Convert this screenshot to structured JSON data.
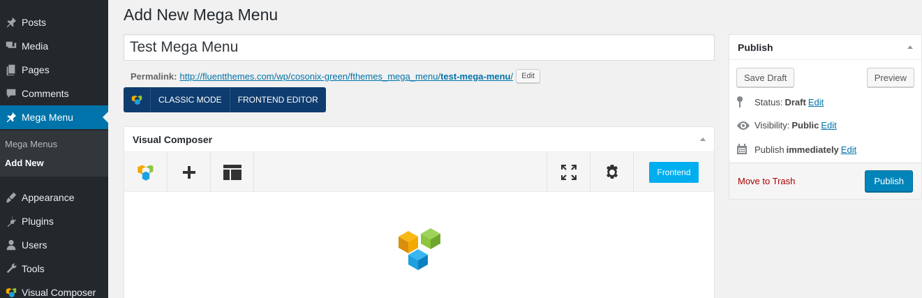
{
  "sidebar": {
    "items_top": [
      {
        "label": "Posts",
        "icon": "pin-icon"
      },
      {
        "label": "Media",
        "icon": "media-icon"
      },
      {
        "label": "Pages",
        "icon": "pages-icon"
      },
      {
        "label": "Comments",
        "icon": "comment-icon"
      },
      {
        "label": "Mega Menu",
        "icon": "pin-icon"
      }
    ],
    "submenu": [
      "Mega Menus",
      "Add New"
    ],
    "items_bottom": [
      {
        "label": "Appearance",
        "icon": "brush-icon"
      },
      {
        "label": "Plugins",
        "icon": "plug-icon"
      },
      {
        "label": "Users",
        "icon": "user-icon"
      },
      {
        "label": "Tools",
        "icon": "wrench-icon"
      },
      {
        "label": "Visual Composer",
        "icon": "vc-logo-icon"
      }
    ],
    "accent_color": "#0073aa"
  },
  "page": {
    "title": "Add New Mega Menu",
    "post_title_value": "Test Mega Menu",
    "permalink_label": "Permalink:",
    "permalink_base": "http://fluentthemes.com/wp/cosonix-green/fthemes_mega_menu/",
    "permalink_slug": "test-mega-menu",
    "permalink_trail": "/",
    "permalink_edit": "Edit"
  },
  "vc_toggle": {
    "classic": "CLASSIC MODE",
    "frontend": "FRONTEND EDITOR"
  },
  "vc_box": {
    "title": "Visual Composer",
    "frontend_button": "Frontend"
  },
  "publish": {
    "title": "Publish",
    "save_draft": "Save Draft",
    "preview": "Preview",
    "status_label": "Status:",
    "status_value": "Draft",
    "status_edit": "Edit",
    "visibility_label": "Visibility:",
    "visibility_value": "Public",
    "visibility_edit": "Edit",
    "publish_label": "Publish",
    "publish_value": "immediately",
    "publish_edit": "Edit",
    "trash": "Move to Trash",
    "publish_button": "Publish",
    "button_color": "#0085ba"
  }
}
